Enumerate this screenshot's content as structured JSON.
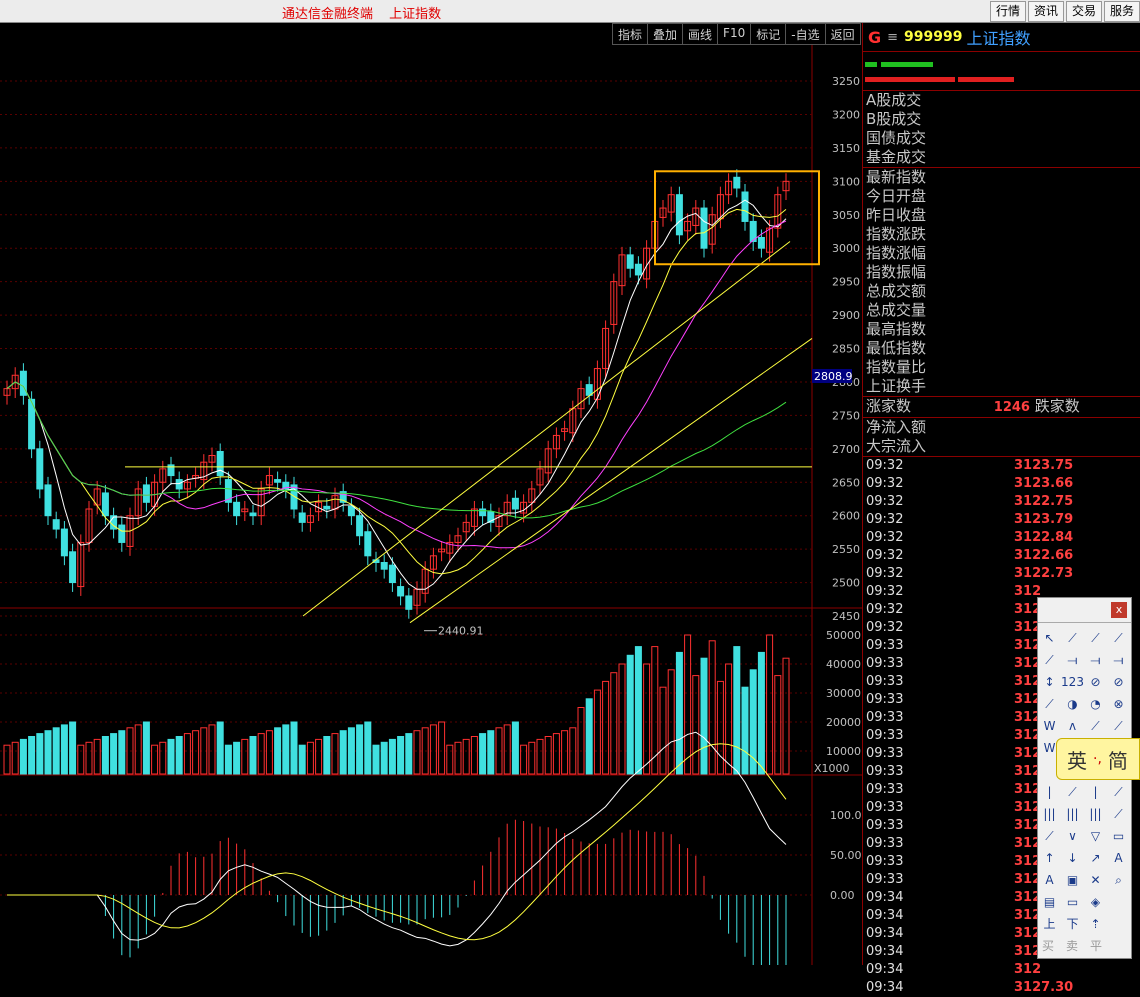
{
  "topbar": {
    "title_app": "通达信金融终端",
    "title_index": "上证指数",
    "buttons": [
      "行情",
      "资讯",
      "交易",
      "服务"
    ]
  },
  "toolbar": [
    "指标",
    "叠加",
    "画线",
    "F10",
    "标记",
    "-自选",
    "返回"
  ],
  "chart": {
    "price_axis": [
      "3250",
      "3200",
      "3150",
      "3100",
      "3050",
      "3000",
      "2950",
      "2900",
      "2850",
      "2800",
      "2750",
      "2700",
      "2650",
      "2600",
      "2550",
      "2500",
      "2450"
    ],
    "current_price_tag": "2808.9",
    "low_label": "2440.91",
    "volume_axis": [
      "50000",
      "40000",
      "30000",
      "20000",
      "10000"
    ],
    "volume_unit": "X1000",
    "macd_axis": [
      "100.0",
      "50.00",
      "0.00"
    ],
    "colors": {
      "up": "#ff3030",
      "down": "#40e0e0",
      "ma5": "#ffffff",
      "ma10": "#ffff40",
      "ma20": "#ff40ff",
      "ma60": "#40e040",
      "box": "#ffb000"
    }
  },
  "panel": {
    "g_label": "G",
    "eq": "≡",
    "code": "999999",
    "name": "上证指数",
    "labels_a": [
      "A股成交",
      "B股成交",
      "国债成交",
      "基金成交"
    ],
    "labels_b": [
      "最新指数",
      "今日开盘",
      "昨日收盘",
      "指数涨跌",
      "指数涨幅",
      "指数振幅",
      "总成交额",
      "总成交量",
      "最高指数",
      "最低指数",
      "指数量比",
      "上证换手"
    ],
    "rise_label": "涨家数",
    "rise_value": "1246",
    "fall_label": "跌家数",
    "labels_c": [
      "净流入额",
      "大宗流入"
    ],
    "ticks": [
      {
        "t": "09:32",
        "p": "3123.75"
      },
      {
        "t": "09:32",
        "p": "3123.66"
      },
      {
        "t": "09:32",
        "p": "3122.75"
      },
      {
        "t": "09:32",
        "p": "3123.79"
      },
      {
        "t": "09:32",
        "p": "3122.84"
      },
      {
        "t": "09:32",
        "p": "3122.66"
      },
      {
        "t": "09:32",
        "p": "3122.73"
      },
      {
        "t": "09:32",
        "p": "312"
      },
      {
        "t": "09:32",
        "p": "312"
      },
      {
        "t": "09:32",
        "p": "312"
      },
      {
        "t": "09:33",
        "p": "312"
      },
      {
        "t": "09:33",
        "p": "312"
      },
      {
        "t": "09:33",
        "p": "312"
      },
      {
        "t": "09:33",
        "p": "312"
      },
      {
        "t": "09:33",
        "p": "312"
      },
      {
        "t": "09:33",
        "p": "312"
      },
      {
        "t": "09:33",
        "p": "312"
      },
      {
        "t": "09:33",
        "p": "312"
      },
      {
        "t": "09:33",
        "p": "312"
      },
      {
        "t": "09:33",
        "p": "312"
      },
      {
        "t": "09:33",
        "p": "312"
      },
      {
        "t": "09:33",
        "p": "312"
      },
      {
        "t": "09:33",
        "p": "312"
      },
      {
        "t": "09:33",
        "p": "312"
      },
      {
        "t": "09:34",
        "p": "312"
      },
      {
        "t": "09:34",
        "p": "312"
      },
      {
        "t": "09:34",
        "p": "312"
      },
      {
        "t": "09:34",
        "p": "312"
      },
      {
        "t": "09:34",
        "p": "312"
      },
      {
        "t": "09:34",
        "p": "3127.30"
      }
    ]
  },
  "palette": {
    "close": "x",
    "tools": [
      "↖",
      "⟋",
      "⟋",
      "⟋",
      "⟋",
      "⟞",
      "⟞",
      "⟞",
      "↕",
      "123",
      "⊘",
      "⊘",
      "⟋",
      "◑",
      "◔",
      "⊗",
      "W",
      "ʌ",
      "⟋",
      "⟋",
      "W",
      "ʌ",
      "",
      "",
      "",
      "",
      "",
      "",
      "|",
      "⟋",
      "|",
      "⟋",
      "|||",
      "|||",
      "|||",
      "⟋",
      "⟋",
      "∨",
      "▽",
      "▭",
      "↑",
      "↓",
      "↗",
      "A",
      "A",
      "▣",
      "✕",
      "⌕",
      "▤",
      "▭",
      "◈",
      "",
      "上",
      "下",
      "⇡",
      ""
    ],
    "bottom": [
      "买",
      "卖",
      "平"
    ]
  },
  "ime": {
    "lang": "英",
    "sep": "·,",
    "mode": "简"
  }
}
